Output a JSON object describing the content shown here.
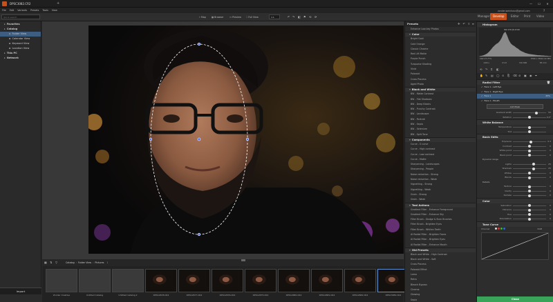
{
  "window": {
    "title": "DPSC3082.CR2",
    "controls": [
      "—",
      "☐",
      "✕"
    ]
  },
  "menu": [
    "File",
    "Edit",
    "Variants",
    "Presets",
    "Tools",
    "View"
  ],
  "user_email": "zonder.weinhaus@gmail.com",
  "modes": [
    {
      "label": "Manager",
      "active": false
    },
    {
      "label": "Develop",
      "active": true
    },
    {
      "label": "Editor",
      "active": false
    },
    {
      "label": "Print",
      "active": false
    },
    {
      "label": "Video",
      "active": false
    }
  ],
  "toolbar": {
    "map": "Map",
    "browser": "Browser",
    "preview": "Preview",
    "fullview": "Full View",
    "zoom": "1:1"
  },
  "left": {
    "search_placeholder": "Quick search",
    "items": [
      {
        "label": "Favorites",
        "level": 0,
        "selected": false
      },
      {
        "label": "Catalog",
        "level": 0,
        "selected": false
      },
      {
        "label": "Folder View",
        "level": 1,
        "selected": true
      },
      {
        "label": "Calendar View",
        "level": 1,
        "selected": false
      },
      {
        "label": "Keyword View",
        "level": 1,
        "selected": false
      },
      {
        "label": "Location View",
        "level": 1,
        "selected": false
      },
      {
        "label": "This PC",
        "level": 0,
        "selected": false
      },
      {
        "label": "Network",
        "level": 0,
        "selected": false
      }
    ],
    "import_label": "Import"
  },
  "filmbar": {
    "crumbs": [
      "Catalog",
      "Folder View",
      "Pictures"
    ],
    "count": "1"
  },
  "filmstrip": [
    {
      "label": "Zonder Creative",
      "kind": "folder"
    },
    {
      "label": "Untitled Catalog",
      "kind": "folder"
    },
    {
      "label": "Untitled Catalog 2",
      "kind": "folder"
    },
    {
      "label": "DPSC2678.CR2",
      "kind": "photo"
    },
    {
      "label": "DPSC2677.CR2",
      "kind": "photo"
    },
    {
      "label": "DPSC2676.CR2",
      "kind": "photo"
    },
    {
      "label": "DPSC2675.CR2",
      "kind": "photo"
    },
    {
      "label": "DPSC2680.CR2",
      "kind": "photo"
    },
    {
      "label": "DPSC2681.CR2",
      "kind": "photo"
    },
    {
      "label": "DPSC2682.CR2",
      "kind": "photo"
    },
    {
      "label": "DPSC3082.CR2",
      "kind": "photo",
      "selected": true
    }
  ],
  "presets": {
    "title": "Presets",
    "top_item": "Enhance Low-key Photos",
    "sections": [
      {
        "name": "Color",
        "items": [
          "Bright Gold",
          "Cold Orange",
          "Classic Chrome",
          "Red Lift Matte",
          "Purple Punch",
          "Turquoise Shading",
          "Vivid",
          "Polaroid",
          "Cross Process",
          "Aged Photo"
        ]
      },
      {
        "name": "Black and White",
        "items": [
          "BW - Matte Contrast",
          "BW - Flat Shadows",
          "BW - Deep Blacks",
          "BW - Punchy Contrast",
          "BW - Landscape",
          "BW - Portrait",
          "BW - Sepia",
          "BW - Selenium",
          "BW - Split Tone"
        ]
      },
      {
        "name": "Components",
        "items": [
          "Curve - S curve",
          "Curve - High contrast",
          "Curve - Low contrast",
          "Curve - Matte",
          "Sharpening - Landscapes",
          "Sharpening - People",
          "Noise reduction - Strong",
          "Noise reduction - Weak",
          "Vignetting - Strong",
          "Vignetting - Weak",
          "Grain - Strong",
          "Grain - Weak"
        ]
      },
      {
        "name": "Tool Actions",
        "items": [
          "Gradient Filter - Enhance Foreground",
          "Gradient Filter - Enhance Sky",
          "Filter Brush - Dodge & Burn Brushes",
          "Filter Brush - Brighten Eyes",
          "Filter Brush - Whiten Teeth",
          "AI Radial Filter - Brighten Faces",
          "AI Radial Filter - Brighten Eyes",
          "AI Radial Filter - Enhance Mouth"
        ]
      },
      {
        "name": "Old Presets",
        "items": [
          "Black and White - High Contrast",
          "Black and White - Soft",
          "Cross Process",
          "Polaroid Effect",
          "Lomo",
          "Retro",
          "Bleach Bypass",
          "Cinema",
          "Glowing",
          "Sepia"
        ]
      }
    ]
  },
  "histogram": {
    "title": "Histogram",
    "exif_top": "ISO 170 ƒ/1.8 60",
    "info_left": "CR2 27,77%",
    "info_right": "5760 x 3840 (22 MP)",
    "exif_row": [
      "1/60 s",
      "f/1.8",
      "ISO 800",
      "85 mm"
    ],
    "bins": [
      2,
      3,
      5,
      8,
      12,
      18,
      26,
      35,
      42,
      48,
      52,
      60,
      72,
      88,
      95,
      80,
      62,
      50,
      44,
      40,
      34,
      30,
      24,
      20,
      17,
      14,
      12,
      10,
      9,
      8,
      7,
      6,
      5,
      5,
      4,
      4,
      3,
      3,
      2,
      2
    ]
  },
  "radial": {
    "title": "Radial Filter",
    "faces": [
      {
        "label": "Face 1 - Left Eye",
        "value": ""
      },
      {
        "label": "Face 1 - Right Eye",
        "value": ""
      },
      {
        "label": "Face 1",
        "value": "25%",
        "selected": true
      },
      {
        "label": "Face 1 - Mouth",
        "value": ""
      }
    ],
    "add_mask": "Add Mask",
    "sliders": [
      {
        "label": "Gradient width",
        "value": "50",
        "pos": 0.7
      },
      {
        "label": "Rotation",
        "value": "0.0°",
        "pos": 0.5
      }
    ]
  },
  "white_balance": {
    "title": "White Balance",
    "sliders": [
      {
        "label": "Temperature",
        "value": "",
        "pos": 0.5
      },
      {
        "label": "Tint",
        "value": "",
        "pos": 0.5
      }
    ]
  },
  "basic": {
    "title": "Basic Edits",
    "sliders": [
      {
        "label": "Exposure",
        "value": "0.3",
        "pos": 0.55
      },
      {
        "label": "Contrast",
        "value": "0",
        "pos": 0.5
      },
      {
        "label": "White point",
        "value": "0",
        "pos": 0.5
      },
      {
        "label": "Black point",
        "value": "0",
        "pos": 0.5
      },
      {
        "label": "Dynamic range",
        "value": "",
        "pos": -1
      },
      {
        "label": "Lights",
        "value": "25",
        "pos": 0.62
      },
      {
        "label": "Shadows",
        "value": "25",
        "pos": 0.62
      },
      {
        "label": "Whites",
        "value": "0",
        "pos": 0.5
      },
      {
        "label": "Blacks",
        "value": "0",
        "pos": 0.5
      },
      {
        "label": "Details",
        "value": "",
        "pos": -1
      },
      {
        "label": "Texture",
        "value": "0",
        "pos": 0.5
      },
      {
        "label": "Clarity",
        "value": "0",
        "pos": 0.5
      },
      {
        "label": "Dehaze",
        "value": "0",
        "pos": 0.5
      }
    ]
  },
  "color": {
    "title": "Color",
    "sliders": [
      {
        "label": "Saturation",
        "value": "0",
        "pos": 0.5
      },
      {
        "label": "Vibrance",
        "value": "0",
        "pos": 0.5
      },
      {
        "label": "Hue",
        "value": "0",
        "pos": 0.5
      },
      {
        "label": "Polarization",
        "value": "0",
        "pos": 0.5
      }
    ]
  },
  "tone_curve": {
    "title": "Tone Curve",
    "channel": "Channel",
    "rgb": "RGB"
  },
  "close_label": "Close"
}
